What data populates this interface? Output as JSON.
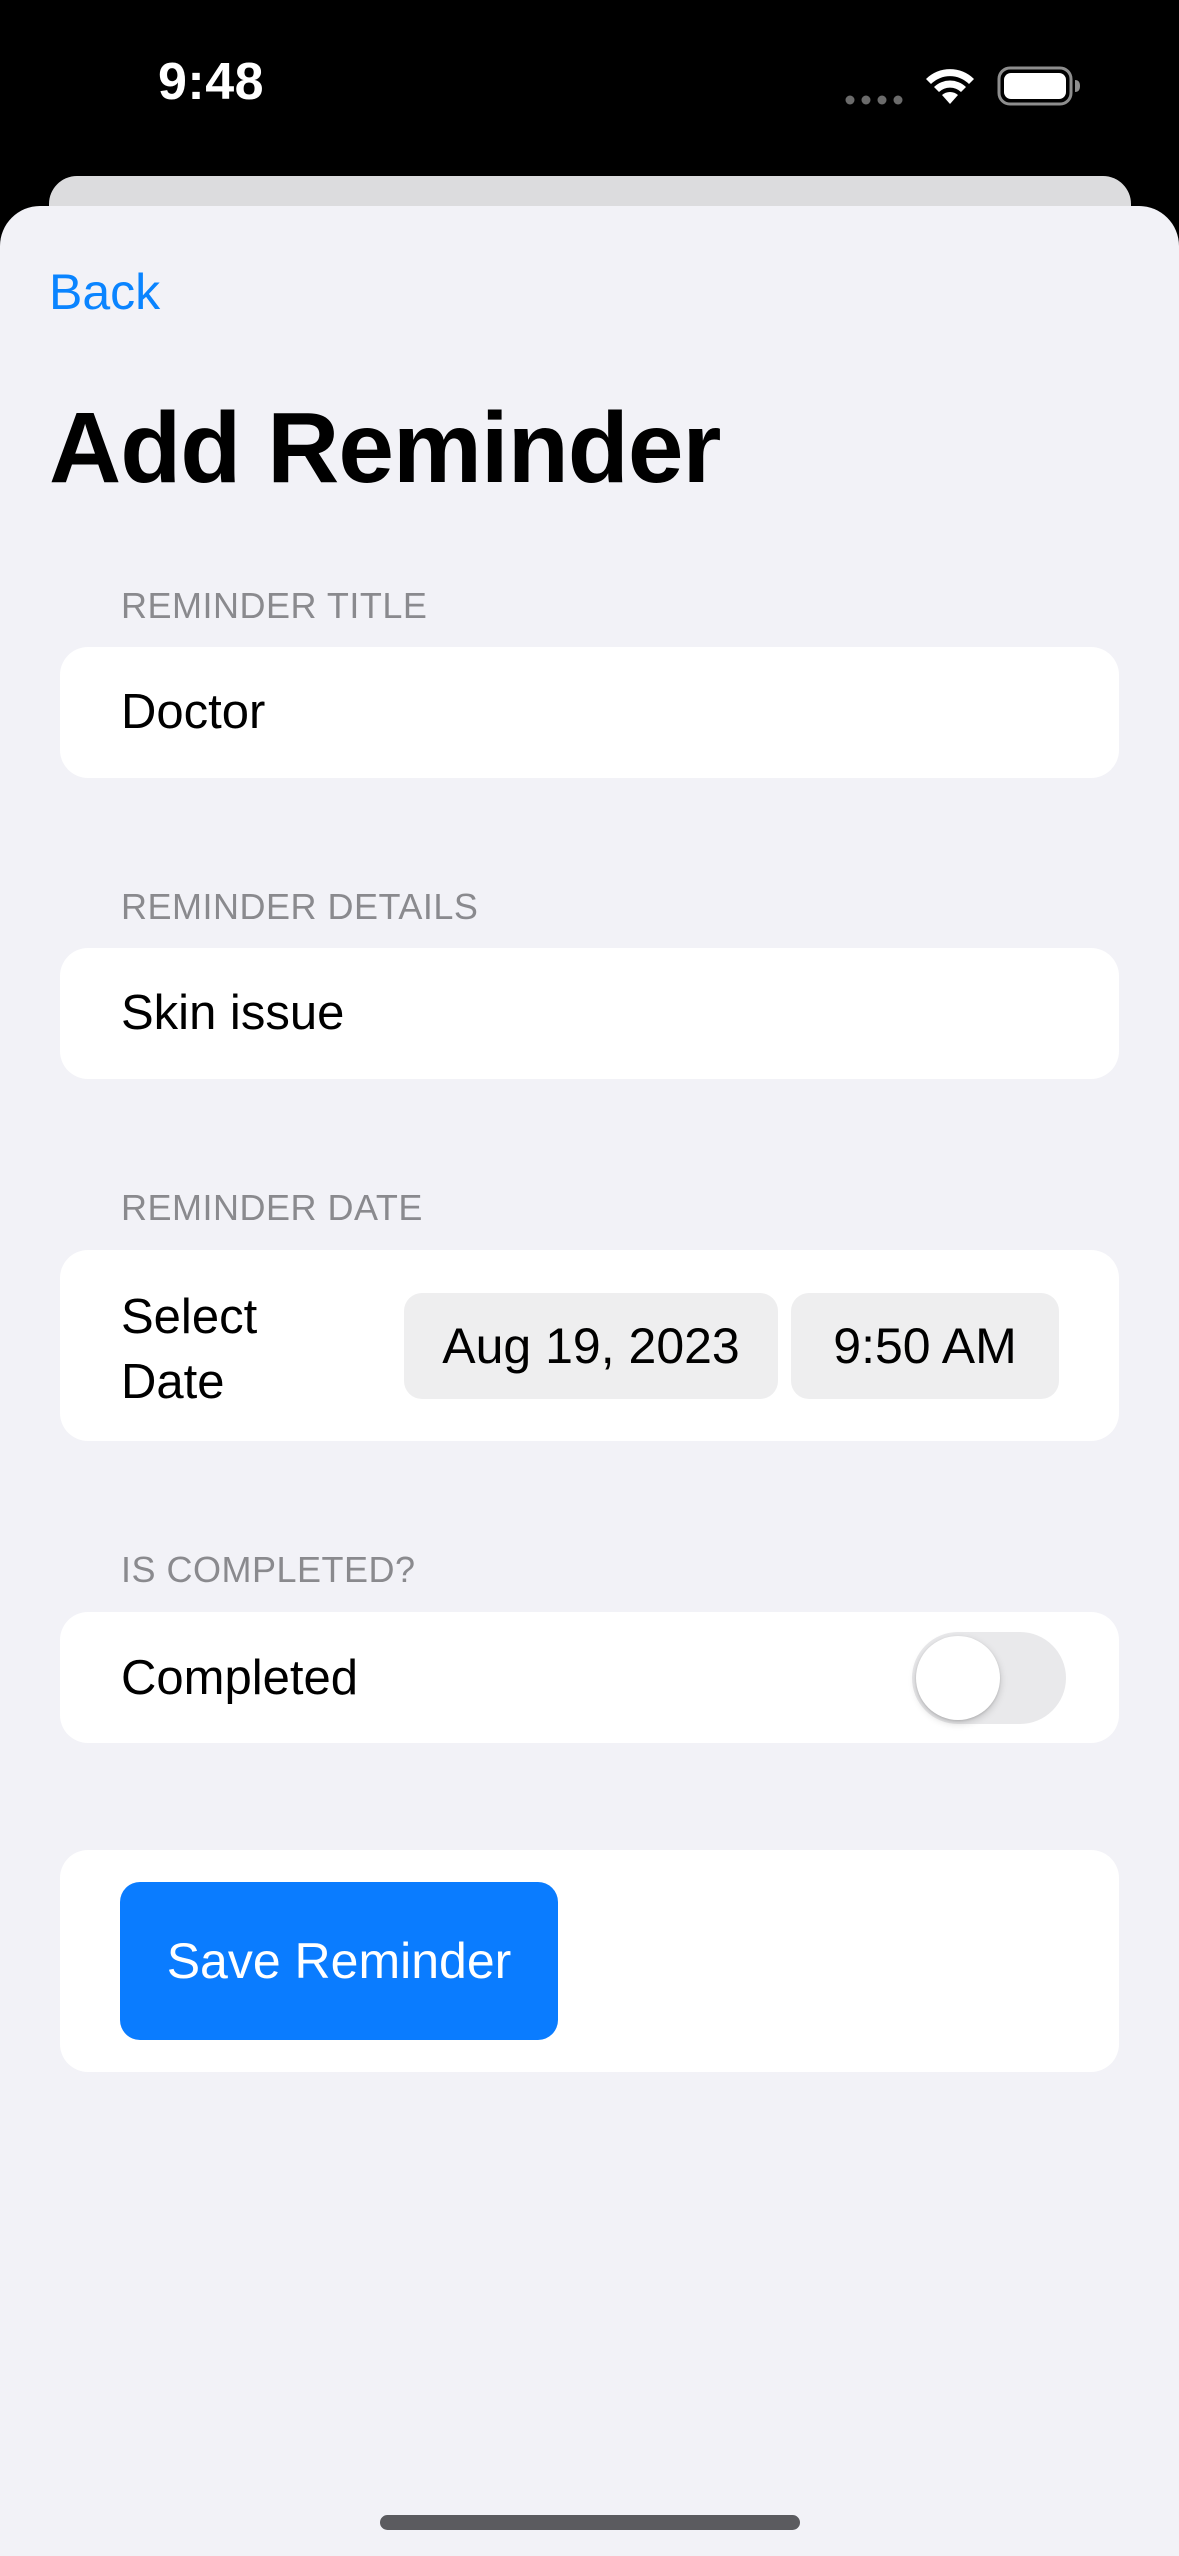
{
  "status_bar": {
    "time": "9:48"
  },
  "nav": {
    "back_label": "Back"
  },
  "page": {
    "title": "Add Reminder"
  },
  "sections": {
    "title": {
      "header": "REMINDER TITLE",
      "value": "Doctor"
    },
    "details": {
      "header": "REMINDER DETAILS",
      "value": "Skin issue"
    },
    "date": {
      "header": "REMINDER DATE",
      "label": "Select Date",
      "date_value": "Aug 19, 2023",
      "time_value": "9:50 AM"
    },
    "completed": {
      "header": "IS COMPLETED?",
      "label": "Completed",
      "toggle_on": false
    }
  },
  "actions": {
    "save_label": "Save Reminder"
  },
  "colors": {
    "accent": "#0a84ff",
    "button": "#0a7cff",
    "background": "#f2f2f7",
    "card": "#ffffff",
    "secondary_text": "#8a8a8e"
  },
  "icons": {
    "signal": "signal-dots-icon",
    "wifi": "wifi-icon",
    "battery": "battery-icon"
  }
}
